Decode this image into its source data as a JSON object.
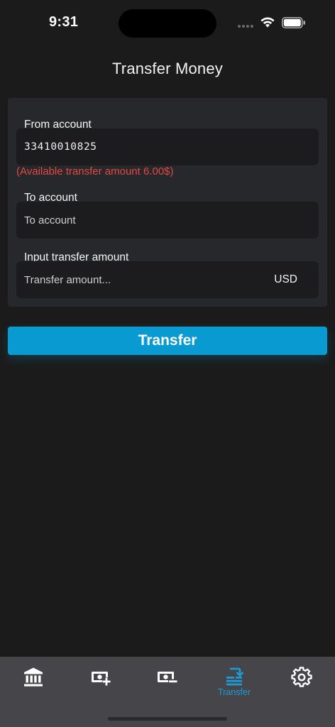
{
  "status_bar": {
    "time": "9:31"
  },
  "header": {
    "title": "Transfer Money"
  },
  "form": {
    "from_account": {
      "label": "From account",
      "value": "33410010825"
    },
    "available_note": "(Available transfer amount 6.00$)",
    "to_account": {
      "label": "To account",
      "placeholder": "To account"
    },
    "amount": {
      "label": "Input transfer amount",
      "placeholder": "Transfer amount...",
      "currency": "USD"
    }
  },
  "actions": {
    "transfer_label": "Transfer"
  },
  "tab_bar": {
    "items": [
      {
        "icon": "bank-icon",
        "label": ""
      },
      {
        "icon": "money-add-icon",
        "label": ""
      },
      {
        "icon": "money-remove-icon",
        "label": ""
      },
      {
        "icon": "transfer-icon",
        "label": "Transfer",
        "active": true
      },
      {
        "icon": "gear-icon",
        "label": ""
      }
    ]
  },
  "colors": {
    "background": "#1b1b1b",
    "card": "#27282b",
    "accent": "#0a9ad2",
    "error": "#e04a42",
    "tab_bar": "#46464a"
  }
}
